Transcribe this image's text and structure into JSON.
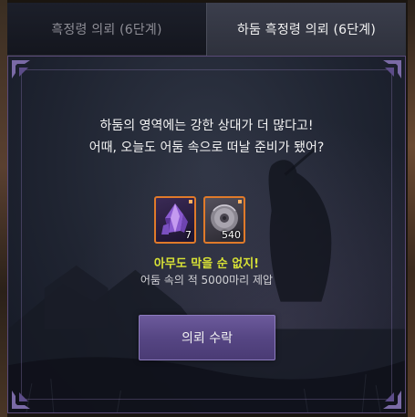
{
  "tabs": [
    {
      "label": "흑정령 의뢰 (6단계)",
      "active": false
    },
    {
      "label": "하둠 흑정령 의뢰 (6단계)",
      "active": true
    }
  ],
  "quest": {
    "message_line1": "하둠의 영역에는 강한 상대가 더 많다고!",
    "message_line2": "어때, 오늘도 어둠 속으로 떠날 준비가 됐어?",
    "rewards": [
      {
        "icon": "purple-crystal-icon",
        "count": "7"
      },
      {
        "icon": "metal-disc-icon",
        "count": "540"
      }
    ],
    "highlight": "아무도 막을 순 없지!",
    "objective": "어둠 속의 적 5000마리 제압",
    "accept_label": "의뢰 수락"
  },
  "colors": {
    "accent": "#564684",
    "highlight_text": "#d8e236",
    "reward_border": "#e07a2a",
    "panel_bg": "#1f2431"
  }
}
